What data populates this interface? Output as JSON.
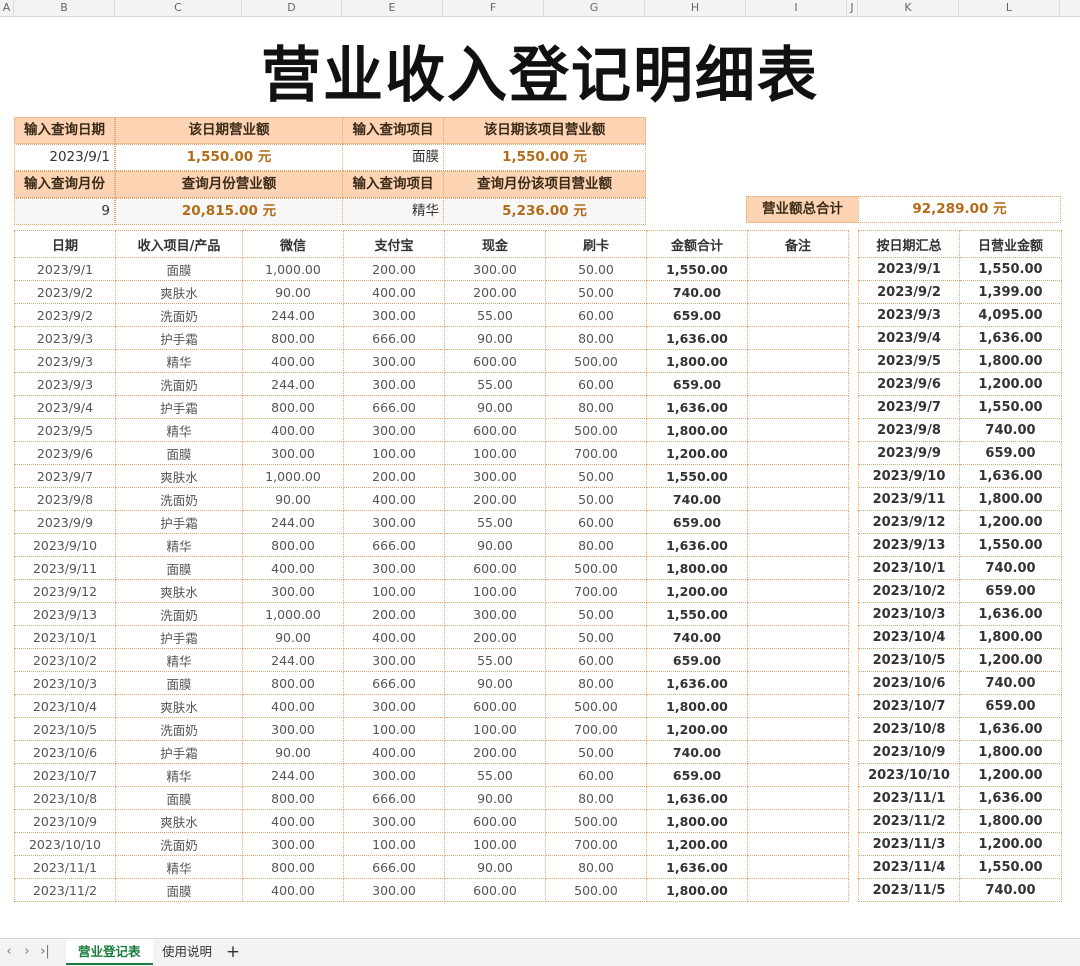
{
  "columns": [
    "A",
    "B",
    "C",
    "D",
    "E",
    "F",
    "G",
    "H",
    "I",
    "J",
    "K",
    "L"
  ],
  "title": "营业收入登记明细表",
  "query": {
    "date_label": "输入查询日期",
    "date_value": "2023/9/1",
    "date_total_label": "该日期营业额",
    "date_total_value": "1,550.00 元",
    "item_label": "输入查询项目",
    "item_value": "面膜",
    "date_item_total_label": "该日期该项目营业额",
    "date_item_total_value": "1,550.00 元",
    "month_label": "输入查询月份",
    "month_value": "9",
    "month_total_label": "查询月份营业额",
    "month_total_value": "20,815.00 元",
    "item2_label": "输入查询项目",
    "item2_value": "精华",
    "month_item_total_label": "查询月份该项目营业额",
    "month_item_total_value": "5,236.00 元",
    "grand_total_label": "营业额总合计",
    "grand_total_value": "92,289.00 元"
  },
  "main_table": {
    "headers": [
      "日期",
      "收入项目/产品",
      "微信",
      "支付宝",
      "现金",
      "刷卡",
      "金额合计",
      "备注"
    ],
    "rows": [
      [
        "2023/9/1",
        "面膜",
        "1,000.00",
        "200.00",
        "300.00",
        "50.00",
        "1,550.00",
        ""
      ],
      [
        "2023/9/2",
        "爽肤水",
        "90.00",
        "400.00",
        "200.00",
        "50.00",
        "740.00",
        ""
      ],
      [
        "2023/9/2",
        "洗面奶",
        "244.00",
        "300.00",
        "55.00",
        "60.00",
        "659.00",
        ""
      ],
      [
        "2023/9/3",
        "护手霜",
        "800.00",
        "666.00",
        "90.00",
        "80.00",
        "1,636.00",
        ""
      ],
      [
        "2023/9/3",
        "精华",
        "400.00",
        "300.00",
        "600.00",
        "500.00",
        "1,800.00",
        ""
      ],
      [
        "2023/9/3",
        "洗面奶",
        "244.00",
        "300.00",
        "55.00",
        "60.00",
        "659.00",
        ""
      ],
      [
        "2023/9/4",
        "护手霜",
        "800.00",
        "666.00",
        "90.00",
        "80.00",
        "1,636.00",
        ""
      ],
      [
        "2023/9/5",
        "精华",
        "400.00",
        "300.00",
        "600.00",
        "500.00",
        "1,800.00",
        ""
      ],
      [
        "2023/9/6",
        "面膜",
        "300.00",
        "100.00",
        "100.00",
        "700.00",
        "1,200.00",
        ""
      ],
      [
        "2023/9/7",
        "爽肤水",
        "1,000.00",
        "200.00",
        "300.00",
        "50.00",
        "1,550.00",
        ""
      ],
      [
        "2023/9/8",
        "洗面奶",
        "90.00",
        "400.00",
        "200.00",
        "50.00",
        "740.00",
        ""
      ],
      [
        "2023/9/9",
        "护手霜",
        "244.00",
        "300.00",
        "55.00",
        "60.00",
        "659.00",
        ""
      ],
      [
        "2023/9/10",
        "精华",
        "800.00",
        "666.00",
        "90.00",
        "80.00",
        "1,636.00",
        ""
      ],
      [
        "2023/9/11",
        "面膜",
        "400.00",
        "300.00",
        "600.00",
        "500.00",
        "1,800.00",
        ""
      ],
      [
        "2023/9/12",
        "爽肤水",
        "300.00",
        "100.00",
        "100.00",
        "700.00",
        "1,200.00",
        ""
      ],
      [
        "2023/9/13",
        "洗面奶",
        "1,000.00",
        "200.00",
        "300.00",
        "50.00",
        "1,550.00",
        ""
      ],
      [
        "2023/10/1",
        "护手霜",
        "90.00",
        "400.00",
        "200.00",
        "50.00",
        "740.00",
        ""
      ],
      [
        "2023/10/2",
        "精华",
        "244.00",
        "300.00",
        "55.00",
        "60.00",
        "659.00",
        ""
      ],
      [
        "2023/10/3",
        "面膜",
        "800.00",
        "666.00",
        "90.00",
        "80.00",
        "1,636.00",
        ""
      ],
      [
        "2023/10/4",
        "爽肤水",
        "400.00",
        "300.00",
        "600.00",
        "500.00",
        "1,800.00",
        ""
      ],
      [
        "2023/10/5",
        "洗面奶",
        "300.00",
        "100.00",
        "100.00",
        "700.00",
        "1,200.00",
        ""
      ],
      [
        "2023/10/6",
        "护手霜",
        "90.00",
        "400.00",
        "200.00",
        "50.00",
        "740.00",
        ""
      ],
      [
        "2023/10/7",
        "精华",
        "244.00",
        "300.00",
        "55.00",
        "60.00",
        "659.00",
        ""
      ],
      [
        "2023/10/8",
        "面膜",
        "800.00",
        "666.00",
        "90.00",
        "80.00",
        "1,636.00",
        ""
      ],
      [
        "2023/10/9",
        "爽肤水",
        "400.00",
        "300.00",
        "600.00",
        "500.00",
        "1,800.00",
        ""
      ],
      [
        "2023/10/10",
        "洗面奶",
        "300.00",
        "100.00",
        "100.00",
        "700.00",
        "1,200.00",
        ""
      ],
      [
        "2023/11/1",
        "精华",
        "800.00",
        "666.00",
        "90.00",
        "80.00",
        "1,636.00",
        ""
      ],
      [
        "2023/11/2",
        "面膜",
        "400.00",
        "300.00",
        "600.00",
        "500.00",
        "1,800.00",
        ""
      ]
    ]
  },
  "summary_table": {
    "headers": [
      "按日期汇总",
      "日营业金额"
    ],
    "rows": [
      [
        "2023/9/1",
        "1,550.00"
      ],
      [
        "2023/9/2",
        "1,399.00"
      ],
      [
        "2023/9/3",
        "4,095.00"
      ],
      [
        "2023/9/4",
        "1,636.00"
      ],
      [
        "2023/9/5",
        "1,800.00"
      ],
      [
        "2023/9/6",
        "1,200.00"
      ],
      [
        "2023/9/7",
        "1,550.00"
      ],
      [
        "2023/9/8",
        "740.00"
      ],
      [
        "2023/9/9",
        "659.00"
      ],
      [
        "2023/9/10",
        "1,636.00"
      ],
      [
        "2023/9/11",
        "1,800.00"
      ],
      [
        "2023/9/12",
        "1,200.00"
      ],
      [
        "2023/9/13",
        "1,550.00"
      ],
      [
        "2023/10/1",
        "740.00"
      ],
      [
        "2023/10/2",
        "659.00"
      ],
      [
        "2023/10/3",
        "1,636.00"
      ],
      [
        "2023/10/4",
        "1,800.00"
      ],
      [
        "2023/10/5",
        "1,200.00"
      ],
      [
        "2023/10/6",
        "740.00"
      ],
      [
        "2023/10/7",
        "659.00"
      ],
      [
        "2023/10/8",
        "1,636.00"
      ],
      [
        "2023/10/9",
        "1,800.00"
      ],
      [
        "2023/10/10",
        "1,200.00"
      ],
      [
        "2023/11/1",
        "1,636.00"
      ],
      [
        "2023/11/2",
        "1,800.00"
      ],
      [
        "2023/11/3",
        "1,200.00"
      ],
      [
        "2023/11/4",
        "1,550.00"
      ],
      [
        "2023/11/5",
        "740.00"
      ]
    ]
  },
  "sheet_tabs": [
    {
      "label": "营业登记表",
      "active": true
    },
    {
      "label": "使用说明",
      "active": false
    }
  ],
  "add_sheet_label": "+",
  "nav": {
    "first": "‹",
    "prev": "›",
    "last": "›|"
  },
  "colors": {
    "header_fill": "#fcd4b4",
    "border": "#e3a56e",
    "amount_text": "#b56a16",
    "active_tab": "#1a7d3e"
  }
}
